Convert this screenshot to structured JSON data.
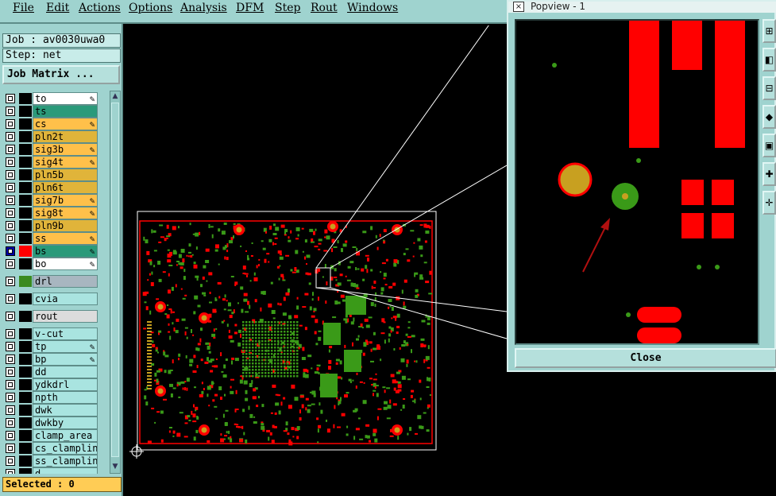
{
  "menubar": {
    "items": [
      "File",
      "Edit",
      "Actions",
      "Options",
      "Analysis",
      "DFM",
      "Step",
      "Rout",
      "Windows"
    ]
  },
  "job": {
    "job_label": "Job : av0030uwa0",
    "step_label": "Step: net",
    "job_matrix_button": "Job Matrix ..."
  },
  "layers": [
    {
      "name": "to",
      "color": "#ffffff",
      "swatch": "#000000",
      "pen": true
    },
    {
      "name": "ts",
      "color": "#2a9a7a",
      "swatch": "#000000",
      "pen": false
    },
    {
      "name": "cs",
      "color": "#ffc04a",
      "swatch": "#000000",
      "pen": true
    },
    {
      "name": "pln2t",
      "color": "#e0b43a",
      "swatch": "#000000",
      "pen": false
    },
    {
      "name": "sig3b",
      "color": "#ffc04a",
      "swatch": "#000000",
      "pen": true
    },
    {
      "name": "sig4t",
      "color": "#ffc04a",
      "swatch": "#000000",
      "pen": true
    },
    {
      "name": "pln5b",
      "color": "#e0b43a",
      "swatch": "#000000",
      "pen": false
    },
    {
      "name": "pln6t",
      "color": "#e0b43a",
      "swatch": "#000000",
      "pen": false
    },
    {
      "name": "sig7b",
      "color": "#ffc04a",
      "swatch": "#000000",
      "pen": true
    },
    {
      "name": "sig8t",
      "color": "#ffc04a",
      "swatch": "#000000",
      "pen": true
    },
    {
      "name": "pln9b",
      "color": "#e0b43a",
      "swatch": "#000000",
      "pen": false
    },
    {
      "name": "ss",
      "color": "#ffc04a",
      "swatch": "#000000",
      "pen": true
    },
    {
      "name": "bs",
      "color": "#2a9a7a",
      "swatch": "#ff0000",
      "pen": true,
      "active": true
    },
    {
      "name": "bo",
      "color": "#ffffff",
      "swatch": "#000000",
      "pen": true
    }
  ],
  "drill_layers": [
    {
      "name": "drl",
      "color": "#a8b6c0",
      "swatch": "#3a8a20"
    },
    {
      "name": "cvia",
      "color": "#a9e4e0",
      "swatch": "#000000"
    },
    {
      "name": "rout",
      "color": "#dcdcdc",
      "swatch": "#000000"
    }
  ],
  "misc_layers": [
    {
      "name": "v-cut",
      "pen": false
    },
    {
      "name": "tp",
      "pen": true
    },
    {
      "name": "bp",
      "pen": true
    },
    {
      "name": "dd",
      "pen": false
    },
    {
      "name": "ydkdrl",
      "pen": false
    },
    {
      "name": "npth",
      "pen": false
    },
    {
      "name": "dwk",
      "pen": false
    },
    {
      "name": "dwkby",
      "pen": false
    },
    {
      "name": "clamp_area",
      "pen": false
    },
    {
      "name": "cs_clampline",
      "pen": false
    },
    {
      "name": "ss_clampline",
      "pen": false
    },
    {
      "name": "d",
      "pen": false
    }
  ],
  "status": {
    "selected": "Selected : 0"
  },
  "popview": {
    "title": "Popview - 1",
    "close_button": "Close",
    "close_x": "×"
  },
  "colors": {
    "panel": "#9fd3cf",
    "pad_red": "#ff0000",
    "via_green": "#3a9a18",
    "drill_gold": "#c8a020"
  },
  "icons": [
    "pen-icon",
    "scroll-up-arrow-icon",
    "scroll-down-arrow-icon",
    "origin-crosshair-icon",
    "zoom-tool-icon"
  ]
}
